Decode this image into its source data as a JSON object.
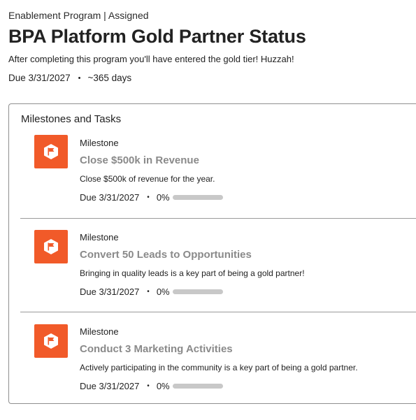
{
  "header": {
    "breadcrumb": "Enablement Program | Assigned",
    "title": "BPA Platform Gold Partner Status",
    "description": "After completing this program you'll have entered the gold tier! Huzzah!",
    "due": "Due 3/31/2027",
    "separator": "•",
    "duration": "~365 days"
  },
  "card": {
    "title": "Milestones and Tasks"
  },
  "milestones": [
    {
      "icon": "flag-icon",
      "kind": "Milestone",
      "title": "Close $500k in Revenue",
      "description": "Close $500k of revenue for the year.",
      "due": "Due 3/31/2027",
      "separator": "•",
      "progress_label": "0%",
      "progress": 0
    },
    {
      "icon": "flag-icon",
      "kind": "Milestone",
      "title": "Convert 50 Leads to Opportunities",
      "description": "Bringing in quality leads is a key part of being a gold partner!",
      "due": "Due 3/31/2027",
      "separator": "•",
      "progress_label": "0%",
      "progress": 0
    },
    {
      "icon": "flag-icon",
      "kind": "Milestone",
      "title": "Conduct 3 Marketing Activities",
      "description": "Actively participating in the community is a key part of being a gold partner.",
      "due": "Due 3/31/2027",
      "separator": "•",
      "progress_label": "0%",
      "progress": 0
    }
  ],
  "colors": {
    "accent": "#f15a29",
    "progress_track": "#c8c8c8",
    "milestone_title": "#8a8a8a"
  }
}
